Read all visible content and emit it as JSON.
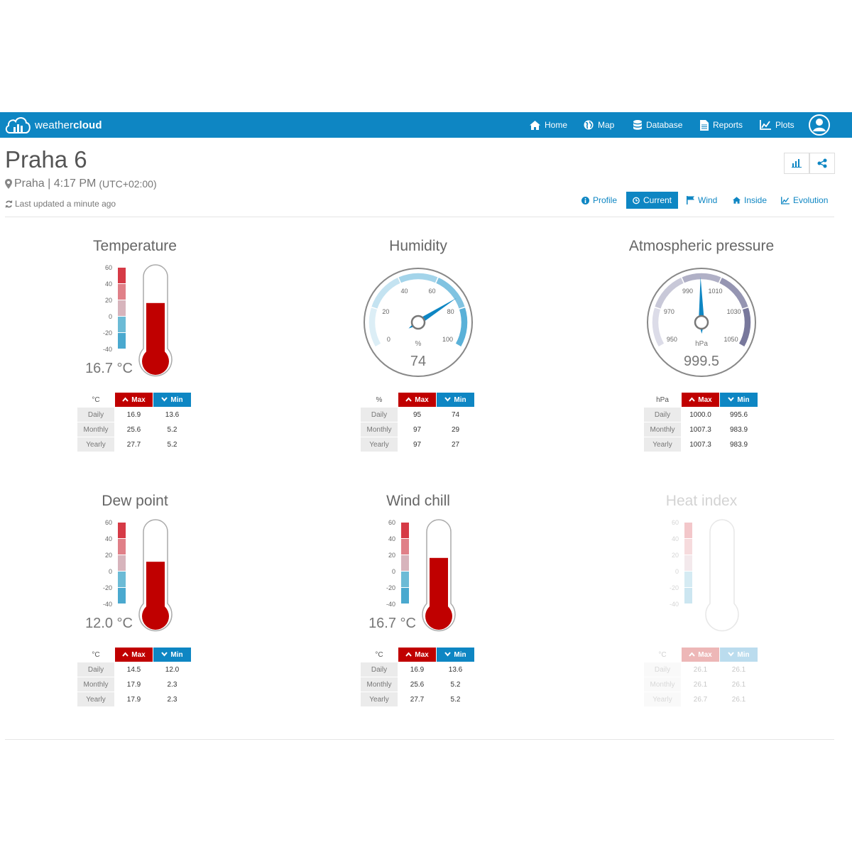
{
  "nav": {
    "brand_light": "weather",
    "brand_bold": "cloud",
    "links": [
      "Home",
      "Map",
      "Database",
      "Reports",
      "Plots"
    ]
  },
  "header": {
    "title": "Praha 6",
    "location": "Praha | 4:17 PM",
    "timezone": "(UTC+02:00)",
    "updated": "Last updated a minute ago"
  },
  "tabs": [
    "Profile",
    "Current",
    "Wind",
    "Inside",
    "Evolution"
  ],
  "active_tab": "Current",
  "colors": {
    "brand": "#0e86c3",
    "max": "#c00000",
    "min": "#0e86c3"
  },
  "stats_headers": {
    "max": "Max",
    "min": "Min",
    "rows": [
      "Daily",
      "Monthly",
      "Yearly"
    ]
  },
  "thermo_scale": [
    "60",
    "40",
    "20",
    "0",
    "-20",
    "-40"
  ],
  "widgets": {
    "temperature": {
      "title": "Temperature",
      "reading": "16.7 °C",
      "value": 16.7,
      "unit": "°C",
      "stats": [
        [
          "16.9",
          "13.6"
        ],
        [
          "25.6",
          "5.2"
        ],
        [
          "27.7",
          "5.2"
        ]
      ]
    },
    "humidity": {
      "title": "Humidity",
      "reading": "74",
      "value": 74,
      "unit": "%",
      "ticks": [
        "0",
        "20",
        "40",
        "60",
        "80",
        "100"
      ],
      "stats": [
        [
          "95",
          "74"
        ],
        [
          "97",
          "29"
        ],
        [
          "97",
          "27"
        ]
      ]
    },
    "pressure": {
      "title": "Atmospheric pressure",
      "reading": "999.5",
      "value": 999.5,
      "unit": "hPa",
      "ticks": [
        "950",
        "970",
        "990",
        "1010",
        "1030",
        "1050"
      ],
      "stats": [
        [
          "1000.0",
          "995.6"
        ],
        [
          "1007.3",
          "983.9"
        ],
        [
          "1007.3",
          "983.9"
        ]
      ]
    },
    "dewpoint": {
      "title": "Dew point",
      "reading": "12.0 °C",
      "value": 12.0,
      "unit": "°C",
      "stats": [
        [
          "14.5",
          "12.0"
        ],
        [
          "17.9",
          "2.3"
        ],
        [
          "17.9",
          "2.3"
        ]
      ]
    },
    "windchill": {
      "title": "Wind chill",
      "reading": "16.7 °C",
      "value": 16.7,
      "unit": "°C",
      "stats": [
        [
          "16.9",
          "13.6"
        ],
        [
          "25.6",
          "5.2"
        ],
        [
          "27.7",
          "5.2"
        ]
      ]
    },
    "heatindex": {
      "title": "Heat index",
      "reading": "",
      "value": null,
      "unit": "°C",
      "stats": [
        [
          "26.1",
          "26.1"
        ],
        [
          "26.1",
          "26.1"
        ],
        [
          "26.7",
          "26.1"
        ]
      ]
    }
  }
}
